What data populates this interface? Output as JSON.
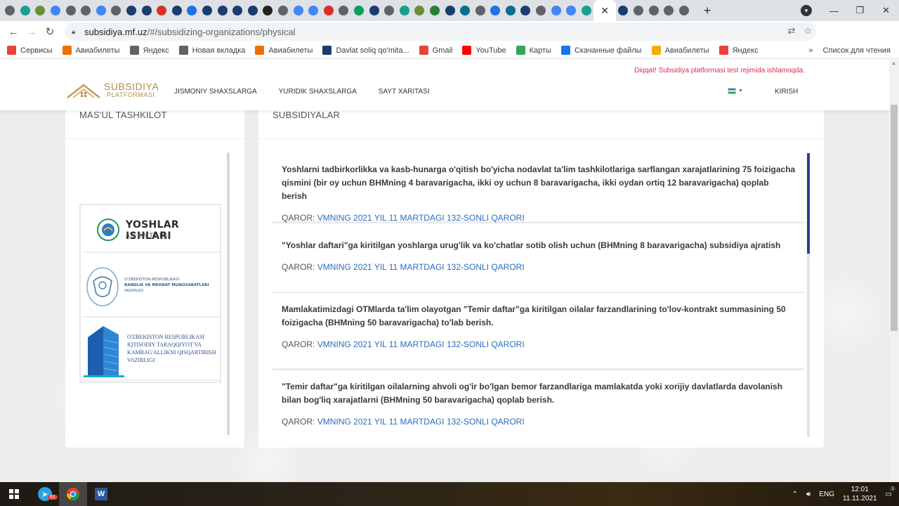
{
  "browser": {
    "url_host": "subsidiya.mf.uz",
    "url_path": "/#/subsidizing-organizations/physical",
    "active_tab_close": "✕",
    "new_tab": "+",
    "bookmarks": [
      {
        "label": "Сервисы",
        "icon": "apps-grid-icon",
        "color": "#ea4335"
      },
      {
        "label": "Авиабилеты",
        "icon": "ticket-icon",
        "color": "#e8710a"
      },
      {
        "label": "Яндекс",
        "icon": "yandex-icon",
        "color": "#5f6368"
      },
      {
        "label": "Новая вкладка",
        "icon": "globe-icon",
        "color": "#5f6368"
      },
      {
        "label": "Авиабилеты",
        "icon": "ticket-icon",
        "color": "#e8710a"
      },
      {
        "label": "Davlat soliq qo'mita...",
        "icon": "k-icon",
        "color": "#1a3c6e"
      },
      {
        "label": "Gmail",
        "icon": "gmail-icon",
        "color": "#ea4335"
      },
      {
        "label": "YouTube",
        "icon": "youtube-icon",
        "color": "#ff0000"
      },
      {
        "label": "Карты",
        "icon": "maps-pin-icon",
        "color": "#34a853"
      },
      {
        "label": "Скачанные файлы",
        "icon": "download-icon",
        "color": "#1a73e8"
      },
      {
        "label": "Авиабилеты",
        "icon": "plane-icon",
        "color": "#f9ab00"
      },
      {
        "label": "Яндекс",
        "icon": "yandex-icon",
        "color": "#ea4335"
      }
    ],
    "more_bookmarks": "»",
    "reading_list": "Список для чтения"
  },
  "site": {
    "notice": "Diqqat! Subsidiya platformasi test rejimida ishlamoqda.",
    "logo_line1": "SUBSIDIYA",
    "logo_line2": "PLATFORMASI",
    "menu": [
      "JISMONIY SHAXSLARGA",
      "YURIDIK SHAXSLARGA",
      "SAYT XARITASI"
    ],
    "login": "KIRISH"
  },
  "left_card": {
    "title": "MAS'UL TASHKILOT",
    "orgs": [
      {
        "line1": "YOSHLAR ISHLARI",
        "line2": "AGENTLIGI"
      },
      {
        "line1": "O'ZBEKISTON RESPUBLIKASI",
        "line2": "BANDLIK VA MEHNAT MUNOSABATLARI",
        "line3": "VAZIRLIGI"
      },
      {
        "line1": "O'ZBEKISTON RESPUBLIKASI",
        "line2": "IQTISODIY TARAQQIYOT VA",
        "line3": "KAMBAG'ALLIKNI QISQARTIRISH",
        "line4": "VAZIRLIGI"
      }
    ]
  },
  "right_card": {
    "title": "SUBSIDIYALAR",
    "decree_prefix": "QAROR:",
    "items": [
      {
        "title": "Yoshlarni tadbirkorlikka va kasb-hunarga o'qitish bo'yicha nodavlat ta'lim tashkilotlariga sarflangan xarajatlarining 75 foizigacha qismini (bir oy uchun BHMning 4 baravarigacha, ikki oy uchun 8 baravarigacha, ikki oydan ortiq 12 baravarigacha) qoplab berish",
        "decree": "VMNING 2021 YIL 11 MARTDAGI 132-SONLI QARORI"
      },
      {
        "title": "\"Yoshlar daftari\"ga kiritilgan yoshlarga urug'lik va ko'chatlar sotib olish uchun (BHMning 8 baravarigacha) subsidiya ajratish",
        "decree": "VMNING 2021 YIL 11 MARTDAGI 132-SONLI QARORI"
      },
      {
        "title": "Mamlakatimizdagi OTMlarda ta'lim olayotgan \"Temir daftar\"ga kiritilgan oilalar farzandlarining to'lov-kontrakt summasining 50 foizigacha (BHMning 50 baravarigacha) to'lab berish.",
        "decree": "VMNING 2021 YIL 11 MARTDAGI 132-SONLI QARORI"
      },
      {
        "title": "\"Temir daftar\"ga kiritilgan oilalarning ahvoli og'ir bo'lgan bemor farzandlariga mamlakatda yoki xorijiy davlatlarda davolanish bilan bog'liq xarajatlarni (BHMning 50 baravarigacha) qoplab berish.",
        "decree": "VMNING 2021 YIL 11 MARTDAGI 132-SONLI QARORI"
      }
    ]
  },
  "taskbar": {
    "telegram_badge": "61",
    "language": "ENG",
    "time": "12:01",
    "date": "11.11.2021",
    "notifications": "1"
  },
  "colors": {
    "accent": "#2a6dc0",
    "notice": "#d6304e",
    "logo_gold": "#b58b4a",
    "scroll_active": "#2e3b8f"
  }
}
